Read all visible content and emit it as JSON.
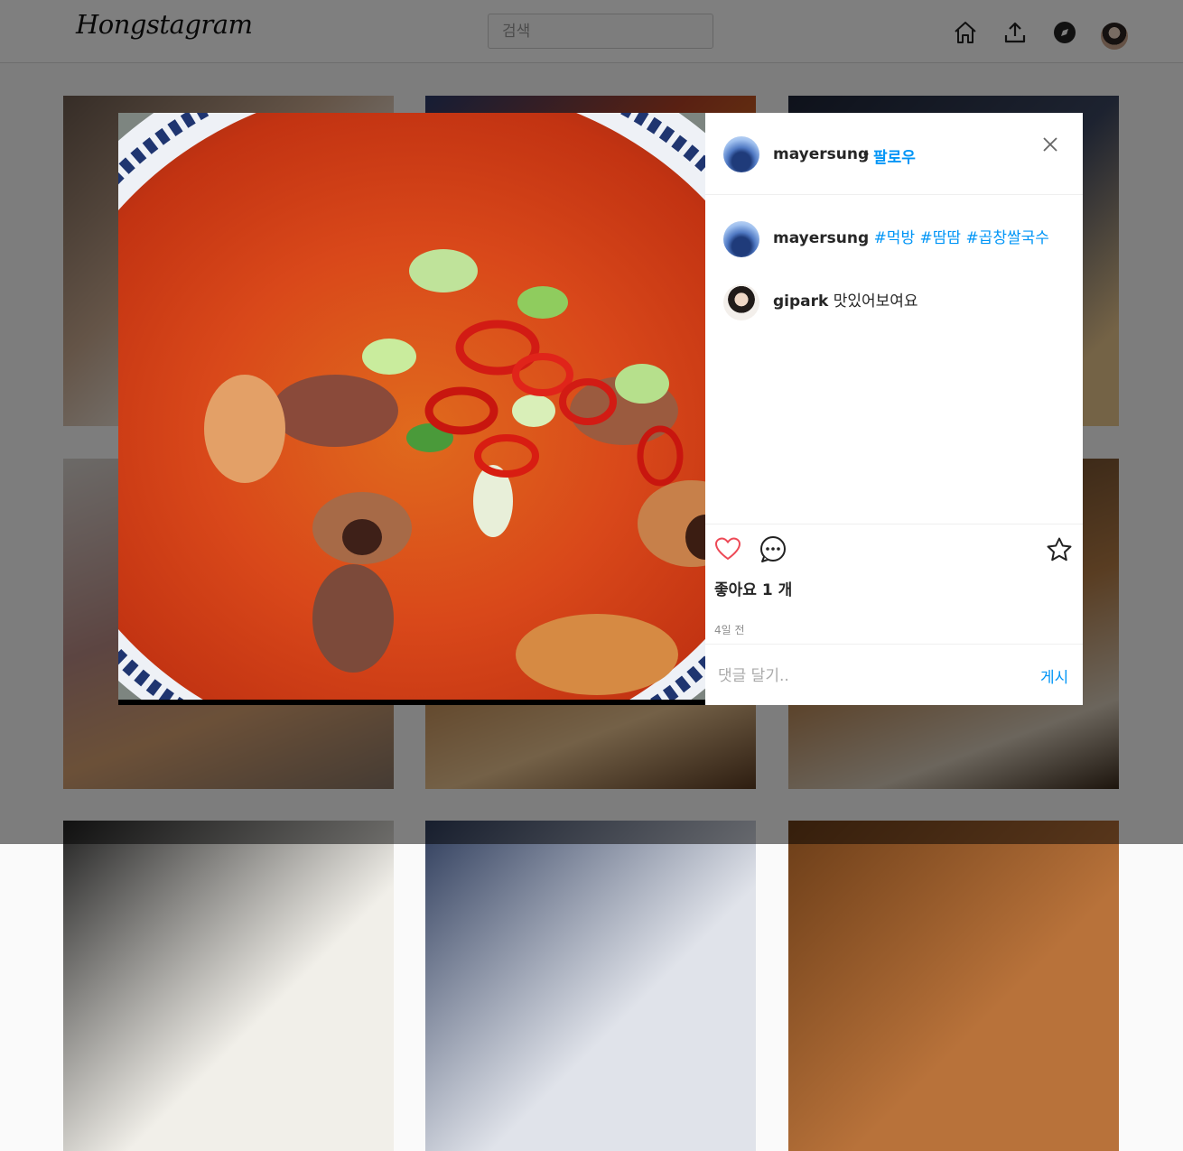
{
  "nav": {
    "logo": "Hongstagram",
    "search_placeholder": "검색"
  },
  "post": {
    "username": "mayersung",
    "separator": "•",
    "follow_label": "팔로우",
    "caption": {
      "username": "mayersung",
      "hashtags": [
        "#먹방",
        "#땀땀",
        "#곱창쌀국수"
      ]
    },
    "comments": [
      {
        "username": "gipark",
        "text": "맛있어보여요"
      }
    ],
    "likes_text": "좋아요 1 개",
    "time_text": "4일 전",
    "comment_placeholder": "댓글 달기..",
    "post_label": "게시"
  },
  "colors": {
    "accent": "#0095f6",
    "like": "#ed4956"
  }
}
